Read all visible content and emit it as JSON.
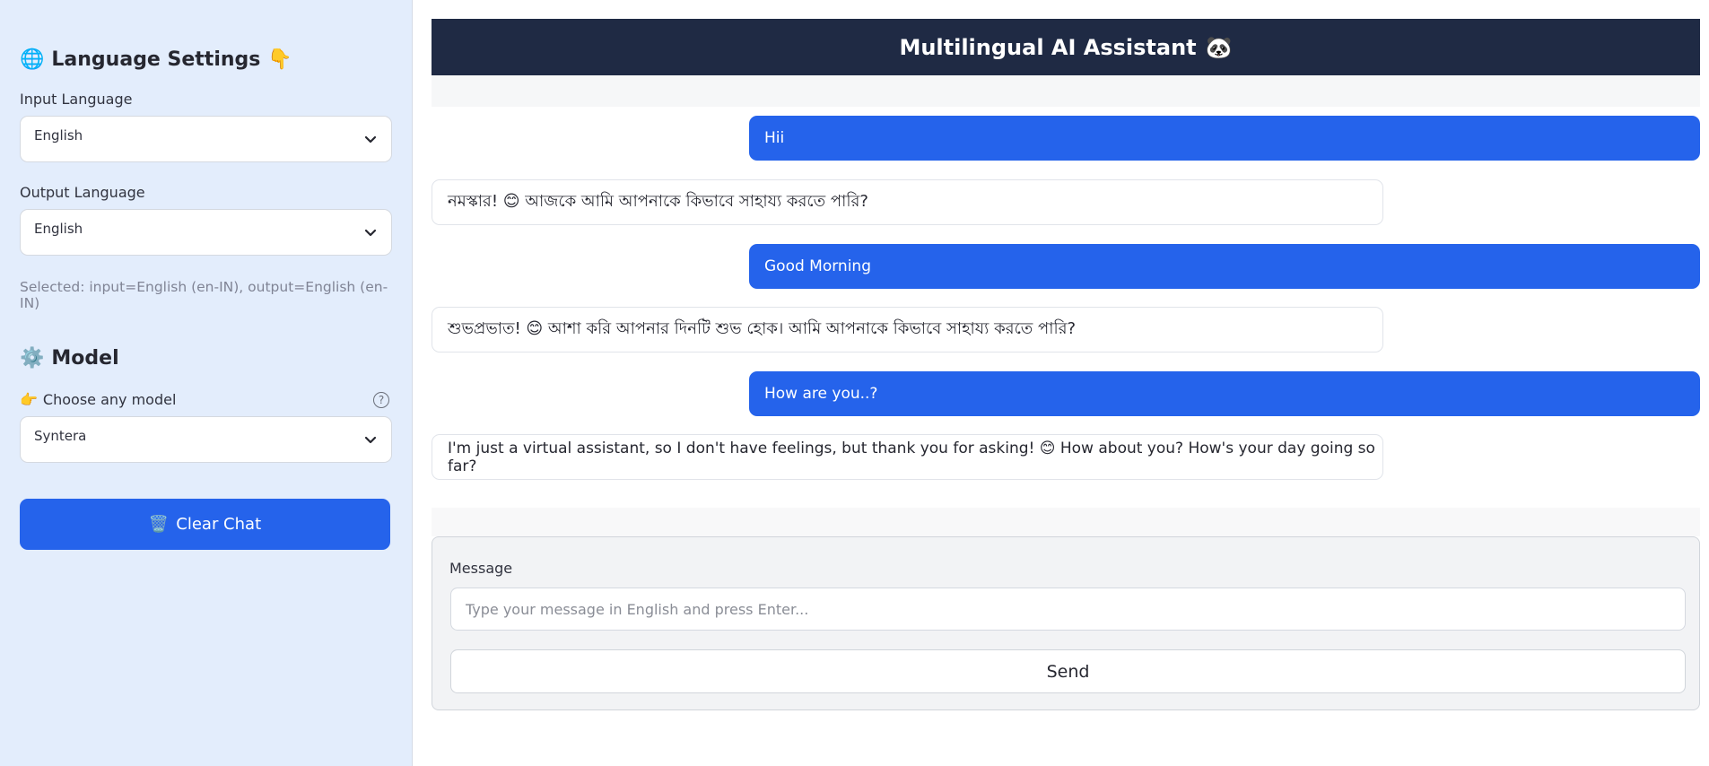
{
  "sidebar": {
    "language_section": {
      "icon": "globe-icon",
      "glyph": "🌐",
      "title": "Language Settings",
      "trailing_glyph": "👇"
    },
    "input_language": {
      "label": "Input Language",
      "value": "English"
    },
    "output_language": {
      "label": "Output Language",
      "value": "English"
    },
    "selected_caption": "Selected: input=English (en-IN), output=English (en-IN)",
    "model_section": {
      "icon": "gear-icon",
      "glyph": "⚙️",
      "title": "Model"
    },
    "model_select": {
      "label_glyph": "👉",
      "label": "Choose any model",
      "value": "Syntera",
      "help_glyph": "?"
    },
    "clear_button": {
      "icon": "trash-icon",
      "glyph": "🗑️",
      "label": "Clear Chat"
    }
  },
  "header": {
    "title": "Multilingual AI Assistant",
    "glyph": "🐼"
  },
  "messages": [
    {
      "role": "user",
      "text": "Hii"
    },
    {
      "role": "assistant",
      "text": "নমস্কার! 😊 আজকে আমি আপনাকে কিভাবে সাহায্য করতে পারি?"
    },
    {
      "role": "user",
      "text": "Good Morning"
    },
    {
      "role": "assistant",
      "text": "শুভপ্রভাত! 😊 আশা করি আপনার দিনটি শুভ হোক। আমি আপনাকে কিভাবে সাহায্য করতে পারি?"
    },
    {
      "role": "user",
      "text": "How are you..?"
    },
    {
      "role": "assistant",
      "text": "I'm just a virtual assistant, so I don't have feelings, but thank you for asking! 😊 How about you? How's your day going so far?"
    }
  ],
  "form": {
    "label": "Message",
    "input_value": "",
    "placeholder": "Type your message in English and press Enter...",
    "send_label": "Send"
  },
  "colors": {
    "accent": "#2563eb",
    "header_bg": "#1f2a44",
    "sidebar_bg": "#e3edfc"
  }
}
